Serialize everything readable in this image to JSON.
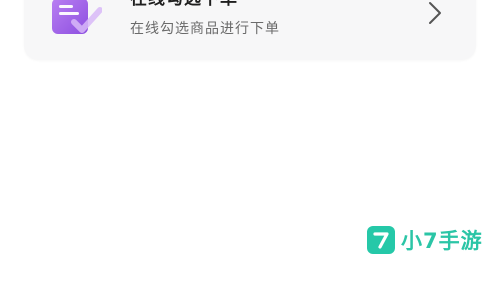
{
  "card": {
    "title": "在线勾选下单",
    "subtitle": "在线勾选商品进行下单",
    "icon": "document-check-icon",
    "icon_color": "#a05ee8",
    "action_icon": "chevron-right-icon"
  },
  "watermark": {
    "logo_glyph": "7",
    "text": "小7手游",
    "color": "#2bc5a6"
  }
}
